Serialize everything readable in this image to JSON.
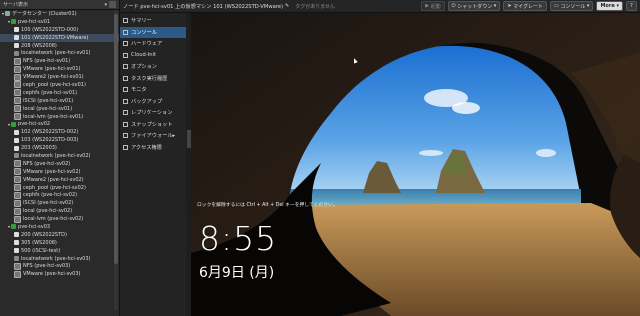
{
  "tree": {
    "header": "サーバ表示",
    "items": [
      {
        "label": "データセンター (Cluster01)",
        "level": 0,
        "kind": "dc",
        "selected": false
      },
      {
        "label": "pve-hci-sv01",
        "level": 1,
        "kind": "node",
        "selected": false
      },
      {
        "label": "100 (WS2022STD-000)",
        "level": 2,
        "kind": "vm",
        "selected": false
      },
      {
        "label": "101 (WS2022STD-VMware)",
        "level": 2,
        "kind": "vm",
        "selected": true
      },
      {
        "label": "208 (WS2008)",
        "level": 2,
        "kind": "vm",
        "selected": false
      },
      {
        "label": "localnetwork (pve-hci-sv01)",
        "level": 2,
        "kind": "net",
        "selected": false
      },
      {
        "label": "NFS (pve-hci-sv01)",
        "level": 2,
        "kind": "st",
        "selected": false
      },
      {
        "label": "VMware (pve-hci-sv01)",
        "level": 2,
        "kind": "st",
        "selected": false
      },
      {
        "label": "VMware2 (pve-hci-sv01)",
        "level": 2,
        "kind": "st",
        "selected": false
      },
      {
        "label": "ceph_pool (pve-hci-sv01)",
        "level": 2,
        "kind": "st",
        "selected": false
      },
      {
        "label": "cephfs (pve-hci-sv01)",
        "level": 2,
        "kind": "st",
        "selected": false
      },
      {
        "label": "iSCSI (pve-hci-sv01)",
        "level": 2,
        "kind": "st",
        "selected": false
      },
      {
        "label": "local (pve-hci-sv01)",
        "level": 2,
        "kind": "st",
        "selected": false
      },
      {
        "label": "local-lvm (pve-hci-sv01)",
        "level": 2,
        "kind": "st",
        "selected": false
      },
      {
        "label": "pve-hci-sv02",
        "level": 1,
        "kind": "node",
        "selected": false
      },
      {
        "label": "102 (WS2022STD-002)",
        "level": 2,
        "kind": "vm",
        "selected": false
      },
      {
        "label": "103 (WS2022STD-003)",
        "level": 2,
        "kind": "vm",
        "selected": false
      },
      {
        "label": "203 (WS2003)",
        "level": 2,
        "kind": "vm",
        "selected": false
      },
      {
        "label": "localnetwork (pve-hci-sv02)",
        "level": 2,
        "kind": "net",
        "selected": false
      },
      {
        "label": "NFS (pve-hci-sv02)",
        "level": 2,
        "kind": "st",
        "selected": false
      },
      {
        "label": "VMware (pve-hci-sv02)",
        "level": 2,
        "kind": "st",
        "selected": false
      },
      {
        "label": "VMware2 (pve-hci-sv02)",
        "level": 2,
        "kind": "st",
        "selected": false
      },
      {
        "label": "ceph_pool (pve-hci-sv02)",
        "level": 2,
        "kind": "st",
        "selected": false
      },
      {
        "label": "cephfs (pve-hci-sv02)",
        "level": 2,
        "kind": "st",
        "selected": false
      },
      {
        "label": "iSCSI (pve-hci-sv02)",
        "level": 2,
        "kind": "st",
        "selected": false
      },
      {
        "label": "local (pve-hci-sv02)",
        "level": 2,
        "kind": "st",
        "selected": false
      },
      {
        "label": "local-lvm (pve-hci-sv02)",
        "level": 2,
        "kind": "st",
        "selected": false
      },
      {
        "label": "pve-hci-sv03",
        "level": 1,
        "kind": "node",
        "selected": false
      },
      {
        "label": "200 (WS2022STD)",
        "level": 2,
        "kind": "vm",
        "selected": false
      },
      {
        "label": "305 (WS2008)",
        "level": 2,
        "kind": "vm",
        "selected": false
      },
      {
        "label": "500 (iSCSI-test)",
        "level": 2,
        "kind": "vm",
        "selected": false
      },
      {
        "label": "localnetwork (pve-hci-sv03)",
        "level": 2,
        "kind": "net",
        "selected": false
      },
      {
        "label": "NFS (pve-hci-sv03)",
        "level": 2,
        "kind": "st",
        "selected": false
      },
      {
        "label": "VMware (pve-hci-sv03)",
        "level": 2,
        "kind": "st",
        "selected": false
      }
    ]
  },
  "topbar": {
    "title": "ノード pve-hci-sv01 上の仮想マシン 101 (WS2022STD-VMware)",
    "tags_placeholder": "タグがありません",
    "buttons": {
      "start": "起動",
      "shutdown": "シャットダウン",
      "migrate": "マイグレート",
      "console": "コンソール",
      "more": "More"
    }
  },
  "submenu": {
    "items": [
      {
        "label": "サマリー",
        "selected": false
      },
      {
        "label": "コンソール",
        "selected": true
      },
      {
        "label": "ハードウェア",
        "selected": false
      },
      {
        "label": "Cloud-Init",
        "selected": false
      },
      {
        "label": "オプション",
        "selected": false
      },
      {
        "label": "タスク実行履歴",
        "selected": false
      },
      {
        "label": "モニタ",
        "selected": false
      },
      {
        "label": "バックアップ",
        "selected": false
      },
      {
        "label": "レプリケーション",
        "selected": false
      },
      {
        "label": "スナップショット",
        "selected": false
      },
      {
        "label": "ファイアウォール",
        "selected": false
      },
      {
        "label": "アクセス権限",
        "selected": false
      }
    ]
  },
  "console": {
    "lock_hint": "ロックを解除するには Ctrl + Alt + Del キーを押してください。",
    "time": "8:55",
    "date": "6月9日 (月)"
  }
}
